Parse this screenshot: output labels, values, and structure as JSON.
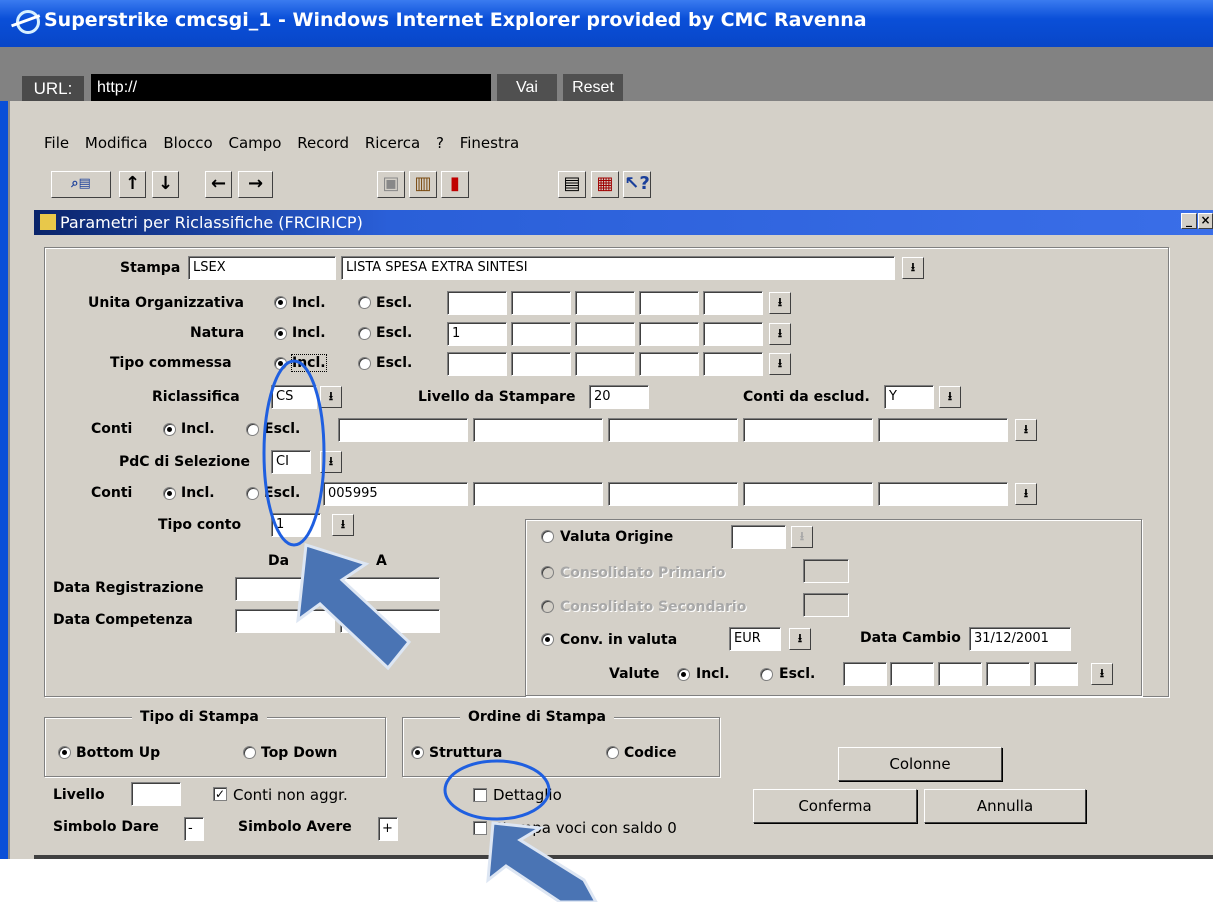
{
  "window": {
    "title": "Superstrike cmcsgi_1 - Windows Internet Explorer provided by CMC Ravenna"
  },
  "urlbar": {
    "label": "URL:",
    "value": "http://",
    "go": "Vai",
    "reset": "Reset"
  },
  "menu": [
    "File",
    "Modifica",
    "Blocco",
    "Campo",
    "Record",
    "Ricerca",
    "?",
    "Finestra"
  ],
  "toolbar_icons": [
    "enter-query-icon",
    "arrow-up-icon",
    "arrow-down-icon",
    "arrow-left-icon",
    "arrow-right-icon",
    "save-icon",
    "delete-icon",
    "exit-icon",
    "clipboard-icon",
    "print-icon",
    "help-icon"
  ],
  "form": {
    "title": "Parametri per Riclassifiche (FRCIRICP)",
    "stampa": {
      "label": "Stampa",
      "code": "LSEX",
      "desc": "LISTA SPESA EXTRA SINTESI"
    },
    "unita": {
      "label": "Unita Organizzativa",
      "values": [
        "",
        "",
        "",
        "",
        ""
      ]
    },
    "natura": {
      "label": "Natura",
      "values": [
        "1",
        "",
        "",
        "",
        ""
      ]
    },
    "tipo_commessa": {
      "label": "Tipo commessa",
      "values": [
        "",
        "",
        "",
        "",
        ""
      ]
    },
    "incl": "Incl.",
    "escl": "Escl.",
    "riclassifica": {
      "label": "Riclassifica",
      "value": "CS"
    },
    "livello_stampare": {
      "label": "Livello da Stampare",
      "value": "20"
    },
    "conti_escl": {
      "label": "Conti da esclud.",
      "value": "Y"
    },
    "conti_label": "Conti",
    "conti1": {
      "values": [
        "",
        "",
        "",
        "",
        ""
      ]
    },
    "pdc": {
      "label": "PdC di Selezione",
      "value": "CI"
    },
    "conti2": {
      "values": [
        "005995",
        "",
        "",
        "",
        ""
      ]
    },
    "tipo_conto": {
      "label": "Tipo conto",
      "value": "1"
    },
    "da": "Da",
    "a": "A",
    "data_registrazione": {
      "label": "Data Registrazione",
      "da": "",
      "a": ""
    },
    "data_competenza": {
      "label": "Data Competenza",
      "da": "",
      "a": ""
    },
    "valuta_origine": {
      "label": "Valuta Origine",
      "value": ""
    },
    "consolidato_primario": {
      "label": "Consolidato Primario",
      "value": ""
    },
    "consolidato_secondario": {
      "label": "Consolidato Secondario",
      "value": ""
    },
    "conv_valuta": {
      "label": "Conv. in valuta",
      "value": "EUR"
    },
    "data_cambio": {
      "label": "Data Cambio",
      "value": "31/12/2001"
    },
    "valute": {
      "label": "Valute",
      "values": [
        "",
        "",
        "",
        "",
        ""
      ]
    },
    "tipo_stampa": {
      "title": "Tipo di Stampa",
      "bottom_up": "Bottom Up",
      "top_down": "Top Down"
    },
    "ordine_stampa": {
      "title": "Ordine di Stampa",
      "struttura": "Struttura",
      "codice": "Codice"
    },
    "colonne": "Colonne",
    "livello": {
      "label": "Livello",
      "value": ""
    },
    "conti_non_aggr": {
      "label": "Conti non aggr.",
      "checked": true
    },
    "dettaglio": {
      "label": "Dettaglio",
      "checked": false
    },
    "conferma": "Conferma",
    "annulla": "Annulla",
    "simbolo_dare": {
      "label": "Simbolo Dare",
      "value": "-"
    },
    "simbolo_avere": {
      "label": "Simbolo Avere",
      "value": "+"
    },
    "stampa_voci": {
      "label": "Stampa voci con saldo 0",
      "checked": false
    }
  },
  "annotation_color": "#4a74b4"
}
